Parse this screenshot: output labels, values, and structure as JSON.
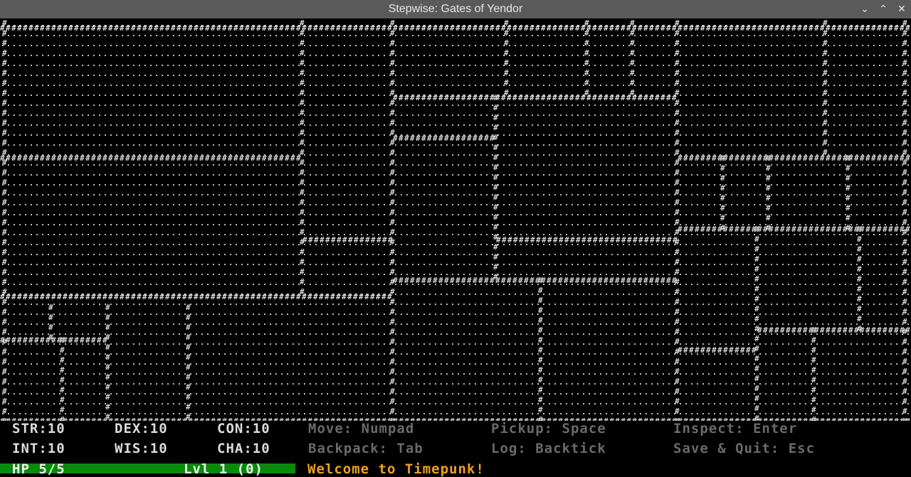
{
  "window": {
    "title": "Stepwise: Gates of Yendor",
    "controls": [
      "chevron-down-icon",
      "chevron-up-icon",
      "close-icon"
    ]
  },
  "map": {
    "wall_glyph": "#",
    "floor_glyph": ".",
    "wall_color": "#d9d9d9",
    "floor_color": "#bcbcbc"
  },
  "stats": {
    "str": "STR:10",
    "dex": "DEX:10",
    "con": "CON:10",
    "int": "INT:10",
    "wis": "WIS:10",
    "cha": "CHA:10"
  },
  "hints": {
    "move": "Move: Numpad",
    "pickup": "Pickup: Space",
    "inspect": "Inspect: Enter",
    "backpack": "Backpack: Tab",
    "log": "Log: Backtick",
    "save_quit": "Save & Quit: Esc"
  },
  "status": {
    "hp_text": "HP 5/5",
    "hp_fraction": 1.0,
    "level_text": "Lvl 1 (0)",
    "hp_bar_color": "#0a8a0a"
  },
  "message": "Welcome to Timepunk!",
  "colors": {
    "titlebar": "#5a5a5a",
    "hint_text": "#6a6a6a",
    "message_text": "#f0a020"
  }
}
